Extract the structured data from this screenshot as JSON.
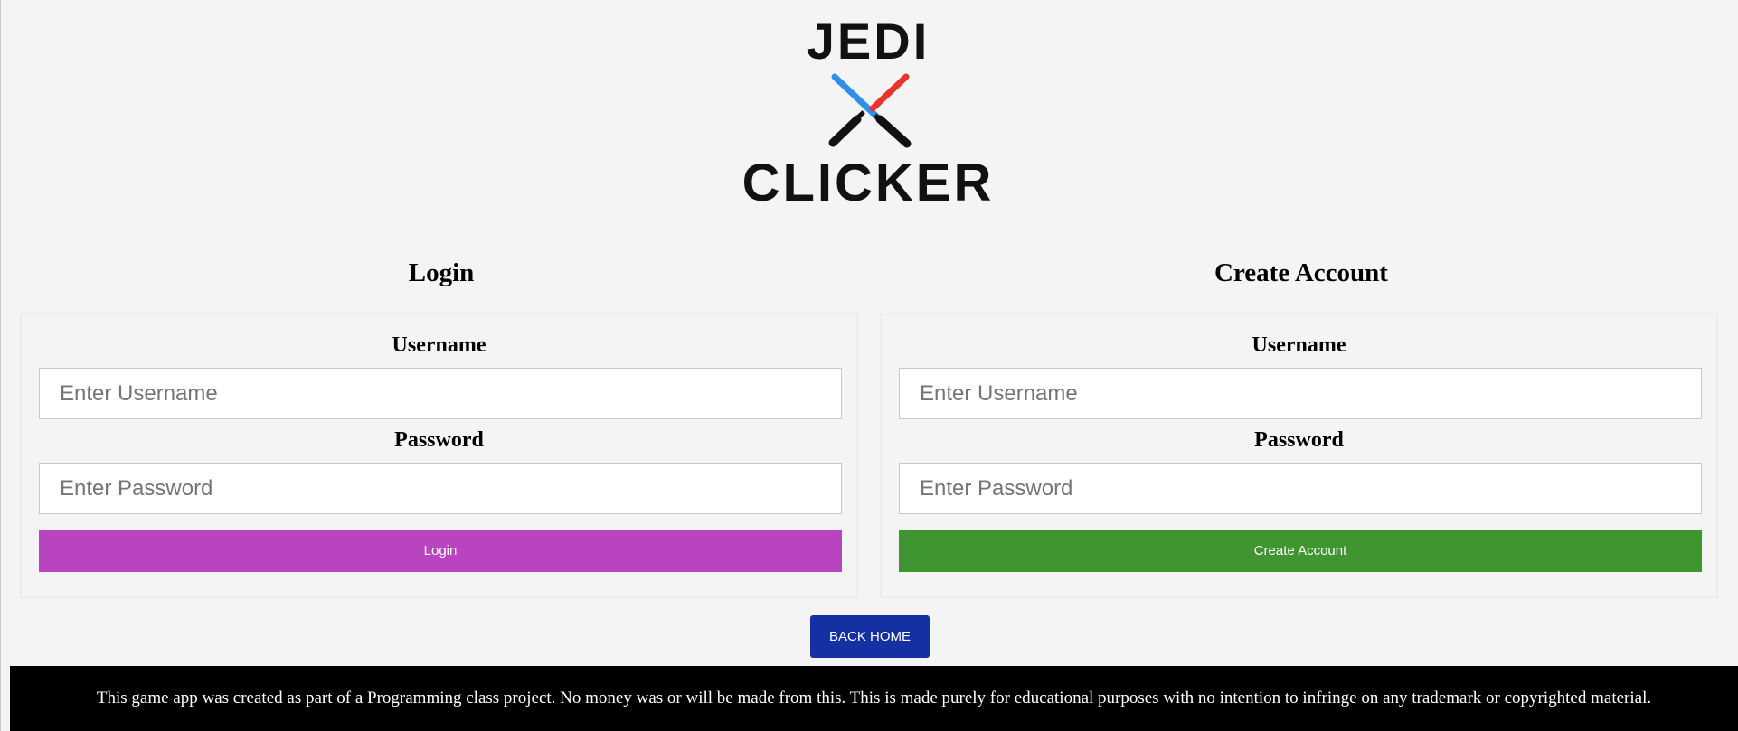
{
  "logo": {
    "line1": "JEDI",
    "line2": "CLICKER",
    "icon": "crossed-lightsabers-icon",
    "colors": {
      "blue_saber": "#2e8fe6",
      "red_saber": "#e8352b",
      "hilt": "#111111"
    }
  },
  "login": {
    "title": "Login",
    "username_label": "Username",
    "username_placeholder": "Enter Username",
    "password_label": "Password",
    "password_placeholder": "Enter Password",
    "button_label": "Login"
  },
  "create_account": {
    "title": "Create Account",
    "username_label": "Username",
    "username_placeholder": "Enter Username",
    "password_label": "Password",
    "password_placeholder": "Enter Password",
    "button_label": "Create Account"
  },
  "back_home_label": "BACK HOME",
  "footer_text": "This game app was created as part of a Programming class project. No money was or will be made from this. This is made purely for educational purposes with no intention to infringe on any trademark or copyrighted material.",
  "colors": {
    "background": "#f4f4f4",
    "login_button": "#b844c0",
    "create_button": "#3f952f",
    "back_home_button": "#1530a3",
    "footer": "#000000"
  }
}
